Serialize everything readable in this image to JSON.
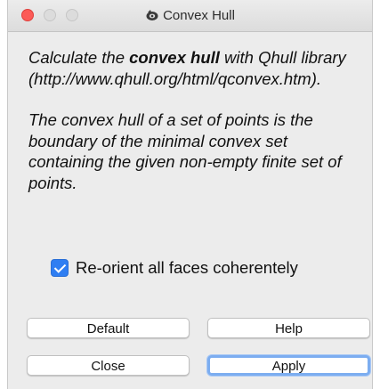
{
  "window": {
    "title": "Convex Hull",
    "icon": "meshlab-app-icon"
  },
  "description": {
    "p1_pre": "Calculate the ",
    "p1_bold": "convex hull",
    "p1_post": " with Qhull library (http://www.qhull.org/html/qconvex.htm).",
    "p2": "The convex hull of a set of points is the boundary of the minimal convex set containing the given non-empty finite set of points."
  },
  "reorient": {
    "label": "Re-orient all faces coherentely",
    "checked": true
  },
  "buttons": {
    "default": "Default",
    "help": "Help",
    "close": "Close",
    "apply": "Apply"
  },
  "colors": {
    "checkbox": "#2f7ef2",
    "focus_ring": "#7cadf0",
    "close_light": "#fc5b57"
  }
}
